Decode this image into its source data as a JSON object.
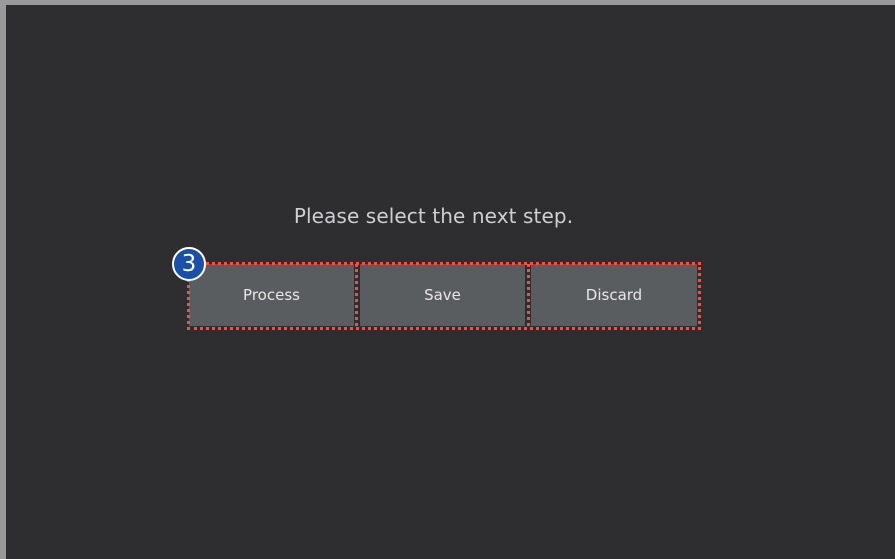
{
  "dialog": {
    "prompt": "Please select the next step.",
    "buttons": [
      {
        "label": "Process"
      },
      {
        "label": "Save"
      },
      {
        "label": "Discard"
      }
    ]
  },
  "annotation": {
    "step_number": "3",
    "badge_color": "#1a4faa",
    "highlight_color": "#ff4a3d"
  },
  "colors": {
    "background": "#2e2e30",
    "button": "#5a5d60",
    "button_text": "#e6e6e6",
    "prompt_text": "#cfcfcf"
  }
}
